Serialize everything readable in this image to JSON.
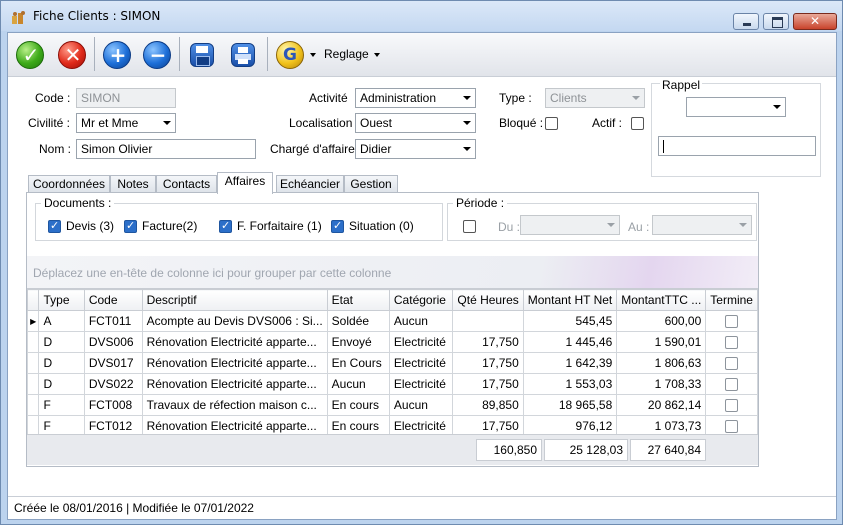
{
  "window": {
    "title": "Fiche Clients : SIMON"
  },
  "toolbar": {
    "reglage_label": "Reglage"
  },
  "form": {
    "code_label": "Code :",
    "code_value": "SIMON",
    "civilite_label": "Civilité :",
    "civilite_value": "Mr et Mme",
    "nom_label": "Nom :",
    "nom_value": "Simon Olivier",
    "activite_label": "Activité",
    "activite_value": "Administration",
    "localisation_label": "Localisation",
    "localisation_value": "Ouest",
    "charge_label": "Chargé d'affaires",
    "charge_value": "Didier",
    "type_label": "Type :",
    "type_value": "Clients",
    "bloque_label": "Bloqué :",
    "actif_label": "Actif :",
    "rappel_label": "Rappel"
  },
  "tabs": [
    "Coordonnées",
    "Notes",
    "Contacts",
    "Affaires",
    "Echéancier",
    "Gestion"
  ],
  "documents": {
    "title": "Documents :",
    "items": [
      {
        "label": "Devis (3)",
        "checked": true
      },
      {
        "label": "Facture(2)",
        "checked": true
      },
      {
        "label": "F. Forfaitaire (1)",
        "checked": true
      },
      {
        "label": "Situation (0)",
        "checked": true
      }
    ]
  },
  "periode": {
    "title": "Période :",
    "du_label": "Du :",
    "au_label": "Au :"
  },
  "grid": {
    "group_hint": "Déplacez une en-tête de colonne ici pour grouper par cette colonne",
    "columns": [
      "Type",
      "Code",
      "Descriptif",
      "Etat",
      "Catégorie",
      "Qté Heures",
      "Montant HT Net",
      "MontantTTC ...",
      "Termine"
    ],
    "rows": [
      [
        "A",
        "FCT011",
        "Acompte au Devis DVS006 : Si...",
        "Soldée",
        "Aucun",
        "",
        "545,45",
        "600,00"
      ],
      [
        "D",
        "DVS006",
        "Rénovation Electricité apparte...",
        "Envoyé",
        "Electricité",
        "17,750",
        "1 445,46",
        "1 590,01"
      ],
      [
        "D",
        "DVS017",
        "Rénovation Electricité apparte...",
        "En Cours",
        "Electricité",
        "17,750",
        "1 642,39",
        "1 806,63"
      ],
      [
        "D",
        "DVS022",
        "Rénovation Electricité apparte...",
        "Aucun",
        "Electricité",
        "17,750",
        "1 553,03",
        "1 708,33"
      ],
      [
        "F",
        "FCT008",
        "Travaux de réfection maison c...",
        "En cours",
        "Aucun",
        "89,850",
        "18 965,58",
        "20 862,14"
      ],
      [
        "F",
        "FCT012",
        "Rénovation Electricité apparte...",
        "En cours",
        "Electricité",
        "17,750",
        "976,12",
        "1 073,73"
      ]
    ],
    "totals": {
      "heures": "160,850",
      "ht": "25 128,03",
      "ttc": "27 640,84"
    }
  },
  "status": {
    "text": "Créée le 08/01/2016 | Modifiée le 07/01/2022"
  }
}
